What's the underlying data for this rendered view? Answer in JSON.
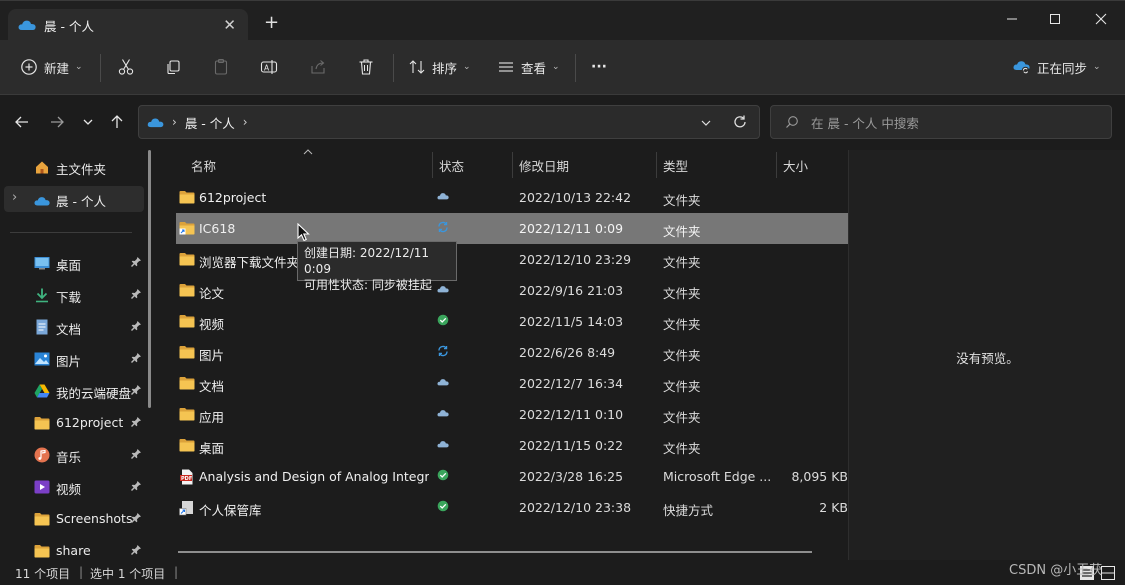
{
  "window": {
    "tab_title": "晨 - 个人",
    "new_tab_symbol": "+",
    "close_tab_symbol": "✕"
  },
  "toolbar": {
    "new_label": "新建",
    "sort_label": "排序",
    "view_label": "查看",
    "more_label": "···",
    "sync_label": "正在同步"
  },
  "address": {
    "crumb": "晨 - 个人",
    "search_placeholder": "在 晨 - 个人 中搜索"
  },
  "sidebar": {
    "home": "主文件夹",
    "onedrive": "晨 - 个人",
    "quick": [
      {
        "label": "桌面",
        "icon": "desktop-icon"
      },
      {
        "label": "下载",
        "icon": "download-icon"
      },
      {
        "label": "文档",
        "icon": "documents-icon"
      },
      {
        "label": "图片",
        "icon": "pictures-icon"
      },
      {
        "label": "我的云端硬盘",
        "icon": "google-drive-icon"
      },
      {
        "label": "612project",
        "icon": "folder-icon"
      },
      {
        "label": "音乐",
        "icon": "music-icon"
      },
      {
        "label": "视频",
        "icon": "videos-icon"
      },
      {
        "label": "Screenshots",
        "icon": "folder-icon"
      },
      {
        "label": "share",
        "icon": "folder-icon"
      }
    ]
  },
  "columns": {
    "name": "名称",
    "status": "状态",
    "modified": "修改日期",
    "type": "类型",
    "size": "大小"
  },
  "files": [
    {
      "name": "612project",
      "status": "cloud",
      "date": "2022/10/13 22:42",
      "type": "文件夹",
      "size": "",
      "icon": "folder"
    },
    {
      "name": "IC618",
      "status": "sync",
      "date": "2022/12/11 0:09",
      "type": "文件夹",
      "size": "",
      "icon": "folder-shortcut"
    },
    {
      "name": "浏览器下载文件夹",
      "status": "",
      "date": "2022/12/10 23:29",
      "type": "文件夹",
      "size": "",
      "icon": "folder"
    },
    {
      "name": "论文",
      "status": "cloud",
      "date": "2022/9/16 21:03",
      "type": "文件夹",
      "size": "",
      "icon": "folder"
    },
    {
      "name": "视频",
      "status": "ok",
      "date": "2022/11/5 14:03",
      "type": "文件夹",
      "size": "",
      "icon": "folder"
    },
    {
      "name": "图片",
      "status": "sync",
      "date": "2022/6/26 8:49",
      "type": "文件夹",
      "size": "",
      "icon": "folder"
    },
    {
      "name": "文档",
      "status": "cloud",
      "date": "2022/12/7 16:34",
      "type": "文件夹",
      "size": "",
      "icon": "folder"
    },
    {
      "name": "应用",
      "status": "cloud",
      "date": "2022/12/11 0:10",
      "type": "文件夹",
      "size": "",
      "icon": "folder"
    },
    {
      "name": "桌面",
      "status": "cloud",
      "date": "2022/11/15 0:22",
      "type": "文件夹",
      "size": "",
      "icon": "folder"
    },
    {
      "name": "Analysis and Design of Analog Integr...",
      "status": "ok",
      "date": "2022/3/28 16:25",
      "type": "Microsoft Edge ...",
      "size": "8,095 KB",
      "icon": "pdf"
    },
    {
      "name": "个人保管库",
      "status": "ok",
      "date": "2022/12/10 23:38",
      "type": "快捷方式",
      "size": "2 KB",
      "icon": "shortcut"
    }
  ],
  "selected_index": 1,
  "tooltip": {
    "line1": "创建日期: 2022/12/11 0:09",
    "line2": "可用性状态: 同步被挂起"
  },
  "preview": {
    "message": "没有预览。"
  },
  "statusbar": {
    "count": "11 个项目",
    "selected": "选中 1 个项目"
  },
  "watermark": "CSDN @小王茯"
}
